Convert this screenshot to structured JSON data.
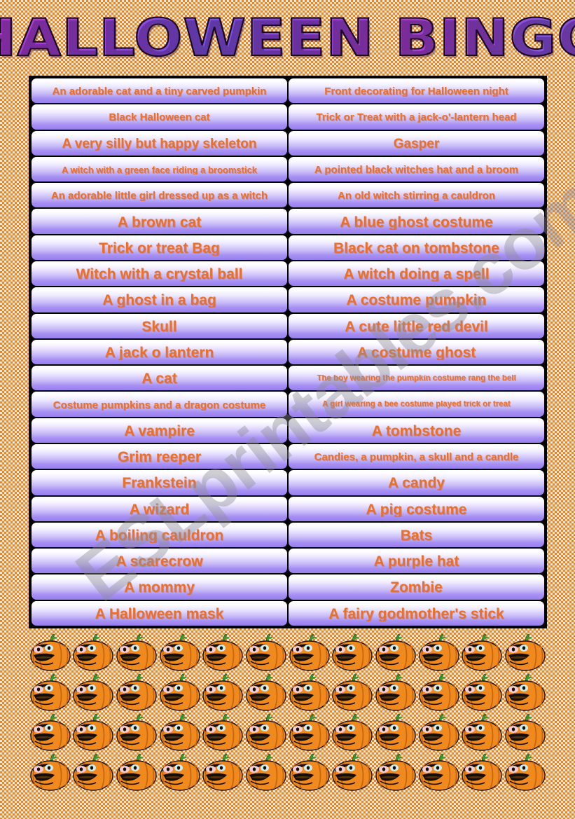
{
  "document": {
    "title": "HALLOWEEN BINGO",
    "watermark": "ESLprintables.com",
    "colors": {
      "background_checker_orange": "#e8862a",
      "background_checker_cream": "#f6e3c8",
      "cell_text_orange": "#e8702a",
      "cell_gradient_top": "#ffffff",
      "cell_gradient_bottom": "#9a7ef0",
      "table_border": "#000000",
      "title_purple": "#8a4be0",
      "title_magenta": "#b43fd0",
      "watermark_gray": "#8c8c96",
      "pumpkin_orange": "#f08a1e",
      "pumpkin_stem_green": "#3c9a35"
    }
  },
  "bingo": {
    "columns": 2,
    "rows": 21,
    "cells": [
      {
        "left": "An adorable cat and a tiny carved pumpkin",
        "left_size": "size-md",
        "right": "Front decorating for Halloween night",
        "right_size": "size-md"
      },
      {
        "left": "Black Halloween cat",
        "left_size": "size-md",
        "right": "Trick or Treat with a jack-o'-lantern head",
        "right_size": "size-md"
      },
      {
        "left": "A very silly but happy skeleton",
        "left_size": "size-lg",
        "right": "Gasper",
        "right_size": "size-lg"
      },
      {
        "left": "A witch with a green face riding a broomstick",
        "left_size": "size-sm",
        "right": "A pointed black witches hat and a broom",
        "right_size": "size-md"
      },
      {
        "left": "An adorable little girl dressed up as a witch",
        "left_size": "size-md",
        "right": "An old witch stirring a cauldron",
        "right_size": "size-md"
      },
      {
        "left": "A brown cat",
        "left_size": "size-xl",
        "right": "A blue ghost costume",
        "right_size": "size-xl"
      },
      {
        "left": "Trick or treat Bag",
        "left_size": "size-xl",
        "right": "Black cat on tombstone",
        "right_size": "size-xl"
      },
      {
        "left": "Witch with a crystal ball",
        "left_size": "size-xl",
        "right": "A witch doing a spell",
        "right_size": "size-xl"
      },
      {
        "left": "A ghost in a bag",
        "left_size": "size-xl",
        "right": "A costume pumpkin",
        "right_size": "size-xl"
      },
      {
        "left": "Skull",
        "left_size": "size-xl",
        "right": "A cute little red devil",
        "right_size": "size-xl"
      },
      {
        "left": "A jack o lantern",
        "left_size": "size-xl",
        "right": "A costume ghost",
        "right_size": "size-xl"
      },
      {
        "left": "A cat",
        "left_size": "size-xl",
        "right": "The boy wearing the pumpkin costume rang the bell",
        "right_size": "size-xs"
      },
      {
        "left": "Costume pumpkins and a dragon costume",
        "left_size": "size-md",
        "right": "A girl wearing a bee costume played trick or treat",
        "right_size": "size-xs"
      },
      {
        "left": "A vampire",
        "left_size": "size-xl",
        "right": "A tombstone",
        "right_size": "size-xl"
      },
      {
        "left": "Grim reeper",
        "left_size": "size-xl",
        "right": "Candies, a pumpkin, a skull and a candle",
        "right_size": "size-md"
      },
      {
        "left": "Frankstein",
        "left_size": "size-xl",
        "right": "A candy",
        "right_size": "size-xl"
      },
      {
        "left": "A wizard",
        "left_size": "size-xl",
        "right": "A pig costume",
        "right_size": "size-xl"
      },
      {
        "left": "A  boiling cauldron",
        "left_size": "size-xl",
        "right": "Bats",
        "right_size": "size-xl"
      },
      {
        "left": "A scarecrow",
        "left_size": "size-xl",
        "right": "A purple hat",
        "right_size": "size-xl"
      },
      {
        "left": "A mommy",
        "left_size": "size-xl",
        "right": "Zombie",
        "right_size": "size-xl"
      },
      {
        "left": "A Halloween mask",
        "left_size": "size-xl",
        "right": "A fairy godmother's stick",
        "right_size": "size-xl"
      }
    ]
  },
  "decoration": {
    "pumpkin_icon_name": "jack-o-lantern-icon",
    "pumpkin_columns": 12,
    "pumpkin_rows": 4,
    "pumpkin_count": 48
  }
}
